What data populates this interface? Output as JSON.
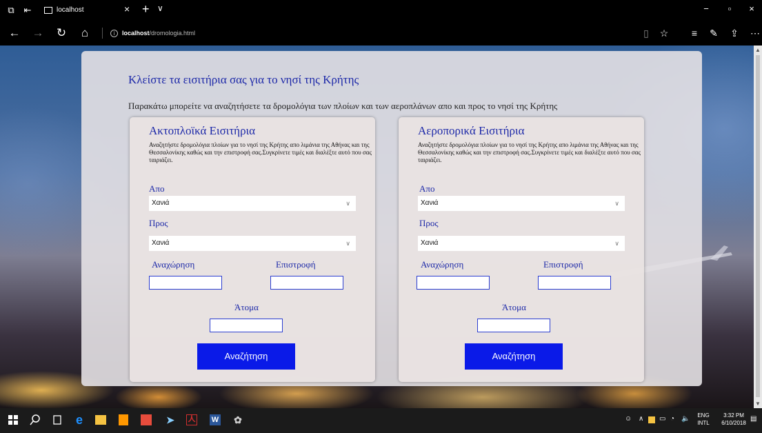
{
  "browser": {
    "tab_title": "localhost",
    "tab_close": "×",
    "tab_new": "+",
    "tab_list": "∨",
    "address_info": "i",
    "address_host": "localhost",
    "address_path": "/dromologia.html",
    "window_controls": {
      "minimize": "−",
      "maximize": "▫",
      "close": "×"
    },
    "nav": {
      "back": "←",
      "forward": "→",
      "refresh": "↻",
      "home": "⌂"
    },
    "tools": {
      "reading": "▯",
      "favorite": "☆",
      "favorites_hub": "≡",
      "notes": "✎",
      "share": "⇪",
      "more": "⋯"
    }
  },
  "page": {
    "title": "Κλείστε τα εισιτήρια σας για το νησί της Κρήτης",
    "intro": "Παρακάτω μπορείτε να αναζητήσετε τα δρομολόγια των πλοίων και των αεροπλάνων απο και προς το νησί της Κρήτης"
  },
  "panels": [
    {
      "title": "Ακτοπλοϊκά Εισιτήρια",
      "description": "Αναζητήστε δρομολόγια πλοίων για το νησί της Κρήτης απο λιμάνια της Αθήνας και της Θεσσαλονίκης καθώς και την επιστροφή σας.Συγκρίνετε τιμές και διαλέξτε αυτό που σας ταιριάζει.",
      "from_label": "Απο",
      "from_value": "Χανιά",
      "to_label": "Προς",
      "to_value": "Χανιά",
      "departure_label": "Αναχώρηση",
      "return_label": "Επιστροφή",
      "people_label": "Άτομα",
      "search_button": "Αναζήτηση"
    },
    {
      "title": "Αεροπορικά Εισιτήρια",
      "description": "Αναζητήστε δρομολόγια πλοίων για το νησί της Κρήτης απο λιμάνια της Αθήνας και της Θεσσαλονίκης καθώς και την επιστροφή σας.Συγκρίνετε τιμές και διαλέξτε αυτό που σας ταιριάζει.",
      "from_label": "Απο",
      "from_value": "Χανιά",
      "to_label": "Προς",
      "to_value": "Χανιά",
      "departure_label": "Αναχώρηση",
      "return_label": "Επιστροφή",
      "people_label": "Άτομα",
      "search_button": "Αναζήτηση"
    }
  ],
  "taskbar": {
    "language_line1": "ENG",
    "language_line2": "INTL",
    "time": "3:32 PM",
    "date": "6/10/2018",
    "accent_colors": {
      "edge": "#1e90ff",
      "explorer": "#f5c342",
      "sublime": "#ff9800",
      "office": "#e74c3c",
      "pdf": "#d32f2f",
      "word": "#2b579a"
    }
  }
}
